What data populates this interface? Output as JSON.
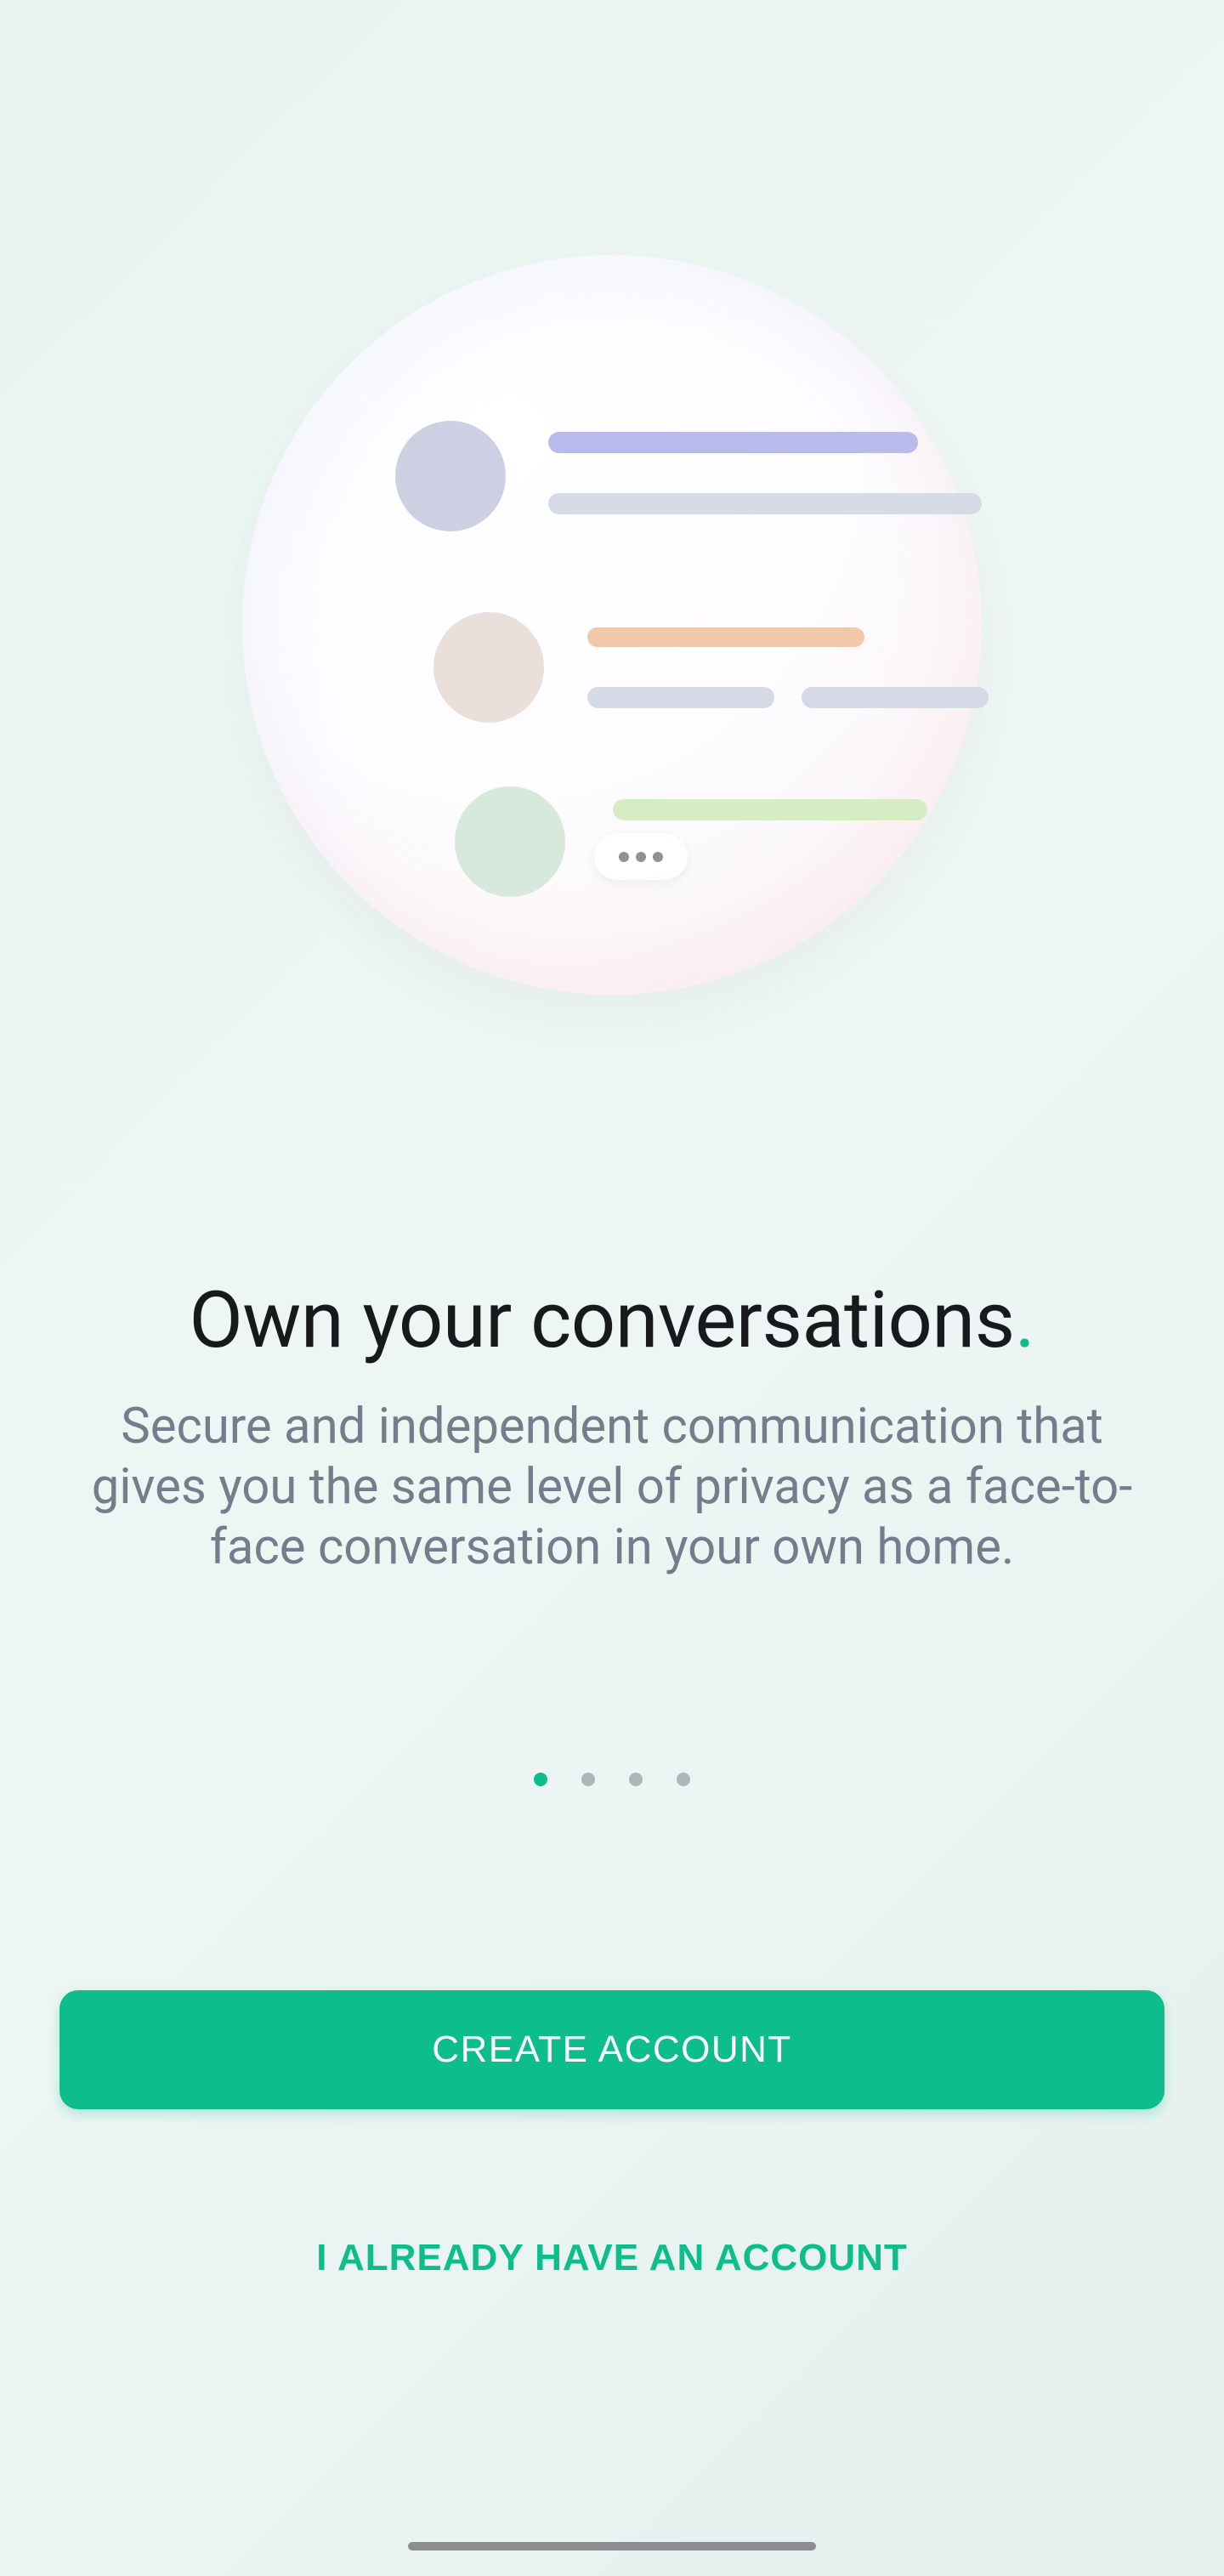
{
  "onboarding": {
    "title": "Own your conversations",
    "title_punct": ".",
    "subtitle": "Secure and independent communication that gives you the same level of privacy as a face-to-face conversation in your own home."
  },
  "pagination": {
    "count": 4,
    "active": 1
  },
  "actions": {
    "create_label": "CREATE ACCOUNT",
    "existing_label": "I ALREADY HAVE AN ACCOUNT"
  },
  "colors": {
    "accent": "#0dbd8b",
    "text_primary": "#17191c",
    "text_secondary": "#737d8c"
  }
}
